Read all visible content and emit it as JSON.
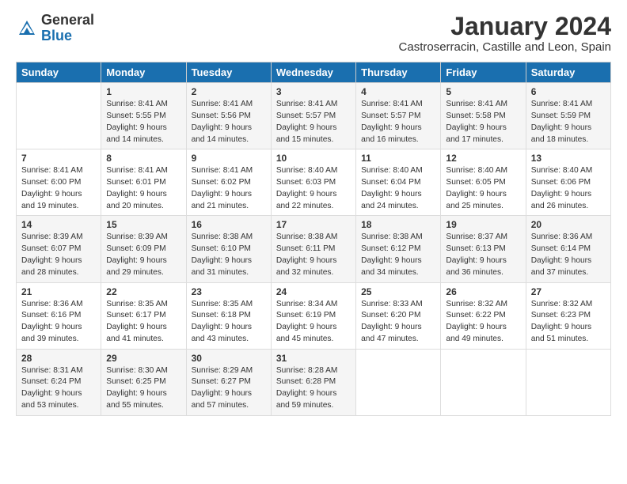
{
  "header": {
    "logo_general": "General",
    "logo_blue": "Blue",
    "month_title": "January 2024",
    "location": "Castroserracin, Castille and Leon, Spain"
  },
  "days_of_week": [
    "Sunday",
    "Monday",
    "Tuesday",
    "Wednesday",
    "Thursday",
    "Friday",
    "Saturday"
  ],
  "weeks": [
    [
      {
        "day": "",
        "info": ""
      },
      {
        "day": "1",
        "info": "Sunrise: 8:41 AM\nSunset: 5:55 PM\nDaylight: 9 hours\nand 14 minutes."
      },
      {
        "day": "2",
        "info": "Sunrise: 8:41 AM\nSunset: 5:56 PM\nDaylight: 9 hours\nand 14 minutes."
      },
      {
        "day": "3",
        "info": "Sunrise: 8:41 AM\nSunset: 5:57 PM\nDaylight: 9 hours\nand 15 minutes."
      },
      {
        "day": "4",
        "info": "Sunrise: 8:41 AM\nSunset: 5:57 PM\nDaylight: 9 hours\nand 16 minutes."
      },
      {
        "day": "5",
        "info": "Sunrise: 8:41 AM\nSunset: 5:58 PM\nDaylight: 9 hours\nand 17 minutes."
      },
      {
        "day": "6",
        "info": "Sunrise: 8:41 AM\nSunset: 5:59 PM\nDaylight: 9 hours\nand 18 minutes."
      }
    ],
    [
      {
        "day": "7",
        "info": "Sunrise: 8:41 AM\nSunset: 6:00 PM\nDaylight: 9 hours\nand 19 minutes."
      },
      {
        "day": "8",
        "info": "Sunrise: 8:41 AM\nSunset: 6:01 PM\nDaylight: 9 hours\nand 20 minutes."
      },
      {
        "day": "9",
        "info": "Sunrise: 8:41 AM\nSunset: 6:02 PM\nDaylight: 9 hours\nand 21 minutes."
      },
      {
        "day": "10",
        "info": "Sunrise: 8:40 AM\nSunset: 6:03 PM\nDaylight: 9 hours\nand 22 minutes."
      },
      {
        "day": "11",
        "info": "Sunrise: 8:40 AM\nSunset: 6:04 PM\nDaylight: 9 hours\nand 24 minutes."
      },
      {
        "day": "12",
        "info": "Sunrise: 8:40 AM\nSunset: 6:05 PM\nDaylight: 9 hours\nand 25 minutes."
      },
      {
        "day": "13",
        "info": "Sunrise: 8:40 AM\nSunset: 6:06 PM\nDaylight: 9 hours\nand 26 minutes."
      }
    ],
    [
      {
        "day": "14",
        "info": "Sunrise: 8:39 AM\nSunset: 6:07 PM\nDaylight: 9 hours\nand 28 minutes."
      },
      {
        "day": "15",
        "info": "Sunrise: 8:39 AM\nSunset: 6:09 PM\nDaylight: 9 hours\nand 29 minutes."
      },
      {
        "day": "16",
        "info": "Sunrise: 8:38 AM\nSunset: 6:10 PM\nDaylight: 9 hours\nand 31 minutes."
      },
      {
        "day": "17",
        "info": "Sunrise: 8:38 AM\nSunset: 6:11 PM\nDaylight: 9 hours\nand 32 minutes."
      },
      {
        "day": "18",
        "info": "Sunrise: 8:38 AM\nSunset: 6:12 PM\nDaylight: 9 hours\nand 34 minutes."
      },
      {
        "day": "19",
        "info": "Sunrise: 8:37 AM\nSunset: 6:13 PM\nDaylight: 9 hours\nand 36 minutes."
      },
      {
        "day": "20",
        "info": "Sunrise: 8:36 AM\nSunset: 6:14 PM\nDaylight: 9 hours\nand 37 minutes."
      }
    ],
    [
      {
        "day": "21",
        "info": "Sunrise: 8:36 AM\nSunset: 6:16 PM\nDaylight: 9 hours\nand 39 minutes."
      },
      {
        "day": "22",
        "info": "Sunrise: 8:35 AM\nSunset: 6:17 PM\nDaylight: 9 hours\nand 41 minutes."
      },
      {
        "day": "23",
        "info": "Sunrise: 8:35 AM\nSunset: 6:18 PM\nDaylight: 9 hours\nand 43 minutes."
      },
      {
        "day": "24",
        "info": "Sunrise: 8:34 AM\nSunset: 6:19 PM\nDaylight: 9 hours\nand 45 minutes."
      },
      {
        "day": "25",
        "info": "Sunrise: 8:33 AM\nSunset: 6:20 PM\nDaylight: 9 hours\nand 47 minutes."
      },
      {
        "day": "26",
        "info": "Sunrise: 8:32 AM\nSunset: 6:22 PM\nDaylight: 9 hours\nand 49 minutes."
      },
      {
        "day": "27",
        "info": "Sunrise: 8:32 AM\nSunset: 6:23 PM\nDaylight: 9 hours\nand 51 minutes."
      }
    ],
    [
      {
        "day": "28",
        "info": "Sunrise: 8:31 AM\nSunset: 6:24 PM\nDaylight: 9 hours\nand 53 minutes."
      },
      {
        "day": "29",
        "info": "Sunrise: 8:30 AM\nSunset: 6:25 PM\nDaylight: 9 hours\nand 55 minutes."
      },
      {
        "day": "30",
        "info": "Sunrise: 8:29 AM\nSunset: 6:27 PM\nDaylight: 9 hours\nand 57 minutes."
      },
      {
        "day": "31",
        "info": "Sunrise: 8:28 AM\nSunset: 6:28 PM\nDaylight: 9 hours\nand 59 minutes."
      },
      {
        "day": "",
        "info": ""
      },
      {
        "day": "",
        "info": ""
      },
      {
        "day": "",
        "info": ""
      }
    ]
  ]
}
